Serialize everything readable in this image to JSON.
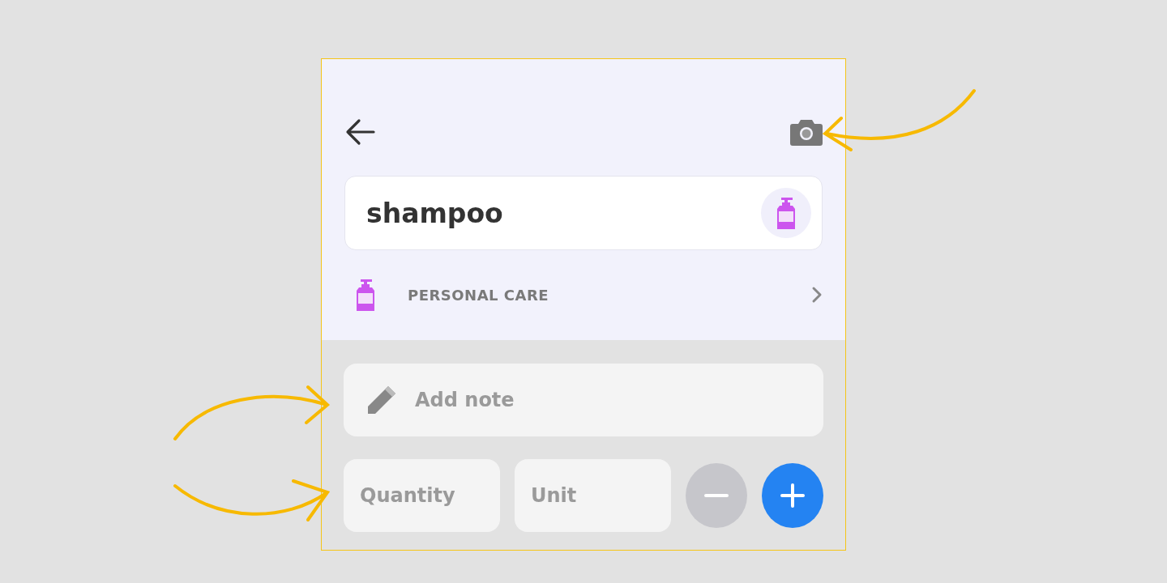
{
  "item": {
    "name": "shampoo"
  },
  "category": {
    "label": "PERSONAL CARE"
  },
  "note": {
    "placeholder": "Add note"
  },
  "quantity": {
    "placeholder": "Quantity"
  },
  "unit": {
    "placeholder": "Unit"
  },
  "decrement": {
    "disabled": true
  },
  "increment": {
    "disabled": false
  }
}
